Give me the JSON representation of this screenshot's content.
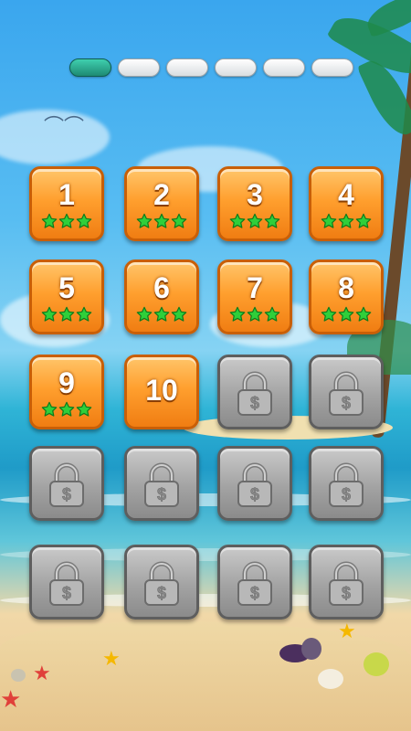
{
  "pager": {
    "pages": 6,
    "active_index": 0
  },
  "levels": [
    {
      "label": "1",
      "stars": 3,
      "locked": false
    },
    {
      "label": "2",
      "stars": 3,
      "locked": false
    },
    {
      "label": "3",
      "stars": 3,
      "locked": false
    },
    {
      "label": "4",
      "stars": 3,
      "locked": false
    },
    {
      "label": "5",
      "stars": 3,
      "locked": false
    },
    {
      "label": "6",
      "stars": 3,
      "locked": false
    },
    {
      "label": "7",
      "stars": 3,
      "locked": false
    },
    {
      "label": "8",
      "stars": 3,
      "locked": false
    },
    {
      "label": "9",
      "stars": 3,
      "locked": false
    },
    {
      "label": "10",
      "stars": 0,
      "locked": false
    },
    {
      "label": "",
      "stars": 0,
      "locked": true
    },
    {
      "label": "",
      "stars": 0,
      "locked": true
    },
    {
      "label": "",
      "stars": 0,
      "locked": true
    },
    {
      "label": "",
      "stars": 0,
      "locked": true
    },
    {
      "label": "",
      "stars": 0,
      "locked": true
    },
    {
      "label": "",
      "stars": 0,
      "locked": true
    },
    {
      "label": "",
      "stars": 0,
      "locked": true
    },
    {
      "label": "",
      "stars": 0,
      "locked": true
    },
    {
      "label": "",
      "stars": 0,
      "locked": true
    },
    {
      "label": "",
      "stars": 0,
      "locked": true
    }
  ],
  "icons": {
    "star": "green-star-icon",
    "lock": "padlock-dollar-icon"
  },
  "colors": {
    "star": "#2fcf3a",
    "tile_open": "#ff9f2e",
    "tile_locked": "#a3a3a3",
    "pill_active": "#1e8a74"
  }
}
